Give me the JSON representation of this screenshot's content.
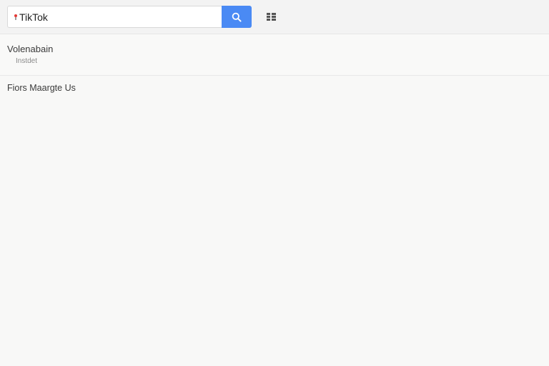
{
  "search": {
    "value": "TikTok",
    "button_icon": "search-icon"
  },
  "toolbar": {
    "grid_icon": "grid-view-icon"
  },
  "results": [
    {
      "title": "Volenabain",
      "subtitle": "Instdet"
    }
  ],
  "footer_link": "Fiors Maargte Us",
  "colors": {
    "accent": "#4a8af4",
    "background": "#f8f8f7",
    "favicon": "#e53935"
  }
}
